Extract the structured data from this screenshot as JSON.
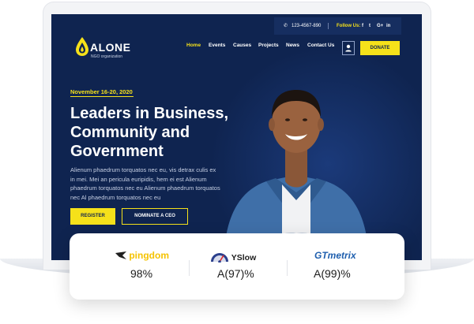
{
  "topbar": {
    "phone": "123-4567-890",
    "follow_label": "Follow Us:",
    "social_icons": [
      "facebook-icon",
      "twitter-icon",
      "google-plus-icon",
      "linkedin-icon"
    ],
    "social_glyphs": [
      "f",
      "t",
      "G+",
      "in"
    ]
  },
  "brand": {
    "name": "ALONE",
    "tagline": "NGO organization"
  },
  "nav": {
    "items": [
      "Home",
      "Events",
      "Causes",
      "Projects",
      "News",
      "Contact Us"
    ],
    "active": "Home",
    "donate_label": "DONATE"
  },
  "hero": {
    "date": "November 16-20, 2020",
    "title_lines": [
      "Leaders in Business,",
      "Community and",
      "Government"
    ],
    "description": "Alienum phaedrum torquatos nec eu, vis detrax culis ex in mei. Mei an pericula euripidis, hem ei est Alienum phaedrum torquatos nec eu Alienum phaedrum torquatos nec Al phaedrum torquatos nec eu",
    "register_label": "REGISTER",
    "nominate_label": "NOMINATE A CEO"
  },
  "metrics": [
    {
      "brand": "pingdom",
      "value": "98%"
    },
    {
      "brand": "YSlow",
      "value": "A(97)%"
    },
    {
      "brand": "GTmetrix",
      "value": "A(99)%"
    }
  ],
  "colors": {
    "navy": "#0f2450",
    "accent_yellow": "#f5e11a",
    "pingdom": "#f5c300",
    "gtmetrix": "#1f5fae"
  }
}
